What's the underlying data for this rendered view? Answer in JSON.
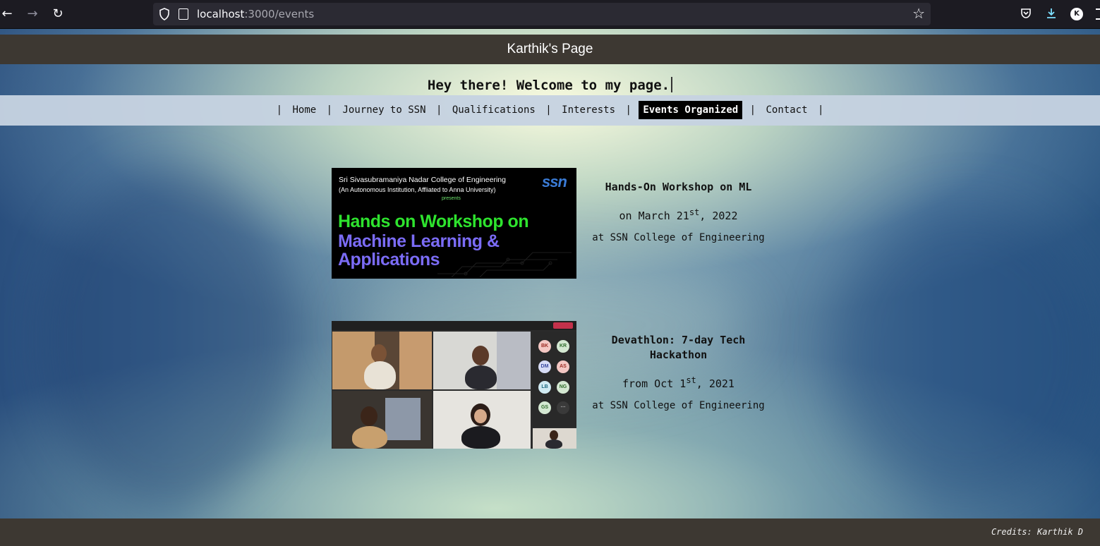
{
  "browser": {
    "url_host": "localhost",
    "url_path": ":3000/events",
    "profile_initial": "K"
  },
  "site": {
    "title": "Karthik's Page",
    "welcome": "Hey there! Welcome to my page.",
    "nav": [
      {
        "label": "Home",
        "active": false
      },
      {
        "label": "Journey to SSN",
        "active": false
      },
      {
        "label": "Qualifications",
        "active": false
      },
      {
        "label": "Interests",
        "active": false
      },
      {
        "label": "Events Organized",
        "active": true
      },
      {
        "label": "Contact",
        "active": false
      }
    ],
    "separator": "|"
  },
  "events": [
    {
      "title": "Hands-On Workshop on ML",
      "date_prefix": "on March 21",
      "date_sup": "st",
      "date_suffix": ", 2022",
      "location": "at SSN College of Engineering",
      "poster": {
        "college": "Sri Sivasubramaniya Nadar College of Engineering",
        "institution": "(An Autonomous Institution, Affliated to Anna University)",
        "presents": "presents",
        "logo": "ssn",
        "line1": "Hands on Workshop on",
        "line2": "Machine Learning &",
        "line3": "Applications"
      }
    },
    {
      "title": "Devathlon: 7-day Tech Hackathon",
      "date_prefix": "from Oct 1",
      "date_sup": "st",
      "date_suffix": ", 2021",
      "location": "at SSN College of Engineering",
      "participants": [
        "BK",
        "KR",
        "DM",
        "AS",
        "LB",
        "NG",
        "GS"
      ]
    }
  ],
  "footer": {
    "credits": "Credits: Karthik D"
  },
  "colors": {
    "header_bg": "#3d3832",
    "nav_bg": "#c6d2e1",
    "active_nav_bg": "#000000",
    "poster_green": "#2ee32e",
    "poster_purple": "#7b6cf6"
  }
}
